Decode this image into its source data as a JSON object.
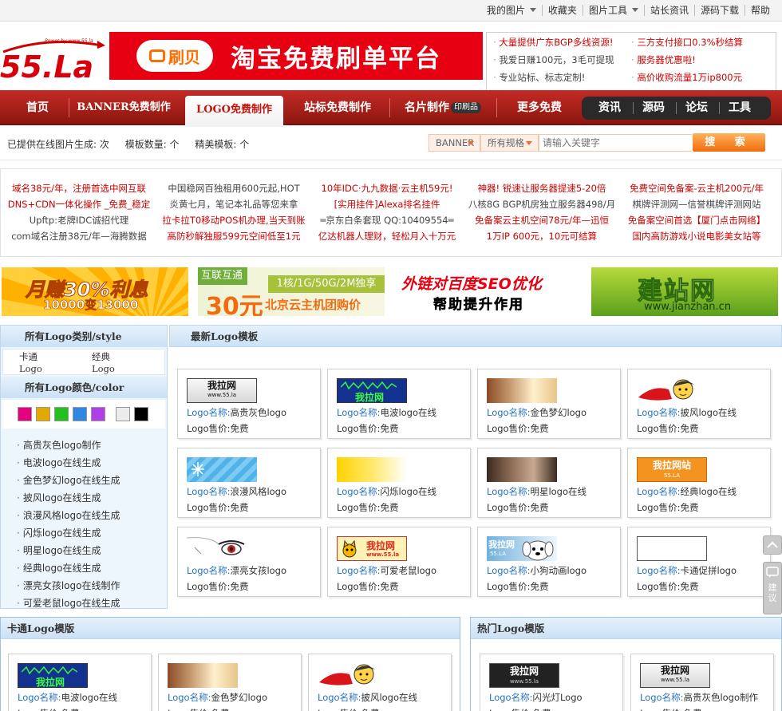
{
  "topbar": {
    "links": [
      "我的图片",
      "收藏夹",
      "图片工具",
      "站长资讯",
      "源码下载",
      "帮助"
    ]
  },
  "logo": {
    "powered_by": "Power by www.55.la",
    "text": "55.La"
  },
  "banner": {
    "brand": "刷贝",
    "slogan": "淘宝免费刷单平台"
  },
  "adbox": {
    "rows": [
      [
        "大量提供广东BGP多线资源!",
        "三方支付接口0.3%秒结算"
      ],
      [
        "我爱日赚100元，3毛可提现",
        "服务器优惠啦!"
      ],
      [
        "专业站标、标志定制!",
        "高价收购流量1万ip800元"
      ]
    ]
  },
  "nav": {
    "items": [
      "首页",
      "BANNER免费制作",
      "LOGO免费制作",
      "站标免费制作",
      "名片制作",
      "更多免费"
    ],
    "card_badge": "印刷品",
    "right_items": [
      "资讯",
      "源码",
      "论坛",
      "工具"
    ]
  },
  "subbar": {
    "stats": [
      "已提供在线图片生成: 次",
      "模板数量: 个",
      "精美模板: 个"
    ],
    "select_type": "BANNER",
    "select_size": "所有规格",
    "search_placeholder": "请输入关键字",
    "search_button": "搜 索"
  },
  "links": [
    [
      "域名38元/年，注册首选中网互联",
      "DNS+CDN一体化操作 _免费_稳定",
      "Upftp:老牌IDC诚招代理",
      "com域名注册38元/年—海腾数据"
    ],
    [
      "中国稳网百独租用600元起,HOT",
      "炎黄七月，笔记本礼品等您来拿",
      "拉卡拉T0移动POS机办理,当天到账",
      "高防秒解独服599元空间低至1元"
    ],
    [
      "10年IDC·九九数据·云主机59元!",
      "[实用挂件]Alexa排名挂件",
      "═京东白条套现 QQ:10409554═",
      "亿达机器人理财，轻松月入十万元"
    ],
    [
      "神器! 锐速让服务器提速5-20倍",
      "八核8G BGP机房独立服务器498/月",
      "免备案云主机空间78元/年—迅恒",
      "1万IP 600元，10元可结算"
    ],
    [
      "免费空间免备案-云主机200元/年",
      "棋牌评测网—信誉棋牌评测网站",
      "免备案空间首选【厦门点击网络】",
      "国内高防游戏小说电影美女站等"
    ]
  ],
  "ads": {
    "ad1": {
      "title": "月赚30%利息",
      "sub": "10000变13000"
    },
    "ad2": {
      "tag": "互联互通",
      "spec": "1核/1G/50G/2M独享",
      "price": "30元",
      "sub": "北京云主机团购价"
    },
    "ad3": {
      "line1": "外链对百度SEO优化",
      "line2": "帮助提升作用"
    },
    "ad4": {
      "title": "建站网",
      "url": "www.jianzhan.cn"
    }
  },
  "sidebar": {
    "category_title": "所有Logo类别/style",
    "categories": [
      "卡通Logo",
      "经典Logo"
    ],
    "color_title": "所有Logo颜色/color",
    "colors": [
      "#e4007f",
      "#e5a800",
      "#22c21c",
      "#2d87e3",
      "#b03fe8",
      "#ececec",
      "#000000"
    ],
    "list": [
      "高贵灰色logo制作",
      "电波logo在线生成",
      "金色梦幻logo在线生成",
      "披风logo在线生成",
      "浪漫风格logo在线生成",
      "闪烁logo在线生成",
      "明星logo在线生成",
      "经典logo在线生成",
      "漂亮女孩logo在线制作",
      "可爱老鼠logo在线生成"
    ]
  },
  "main": {
    "title": "最新Logo模板",
    "name_label": "Logo名称:",
    "price_label": "Logo售价:",
    "cards": [
      {
        "name": "高贵灰色logo",
        "price": "免费",
        "thumb": "gray",
        "thumb_text": "我拉网",
        "thumb_sub": "www.55.la"
      },
      {
        "name": "电波logo在线",
        "price": "免费",
        "thumb": "wave",
        "thumb_text": "我拉网"
      },
      {
        "name": "金色梦幻logo",
        "price": "免费",
        "thumb": "gold"
      },
      {
        "name": "披风logo在线",
        "price": "免费",
        "thumb": "cape"
      },
      {
        "name": "浪漫风格logo",
        "price": "免费",
        "thumb": "blue"
      },
      {
        "name": "闪烁logo在线",
        "price": "免费",
        "thumb": "yellow"
      },
      {
        "name": "明星logo在线",
        "price": "免费",
        "thumb": "face"
      },
      {
        "name": "经典logo在线",
        "price": "免费",
        "thumb": "orange",
        "thumb_text": "我拉网站",
        "thumb_sub": "55.LA"
      },
      {
        "name": "漂亮女孩logo",
        "price": "免费",
        "thumb": "girl"
      },
      {
        "name": "可爱老鼠logo",
        "price": "免费",
        "thumb": "cat",
        "thumb_text": "我拉网",
        "thumb_sub": "www.55.la"
      },
      {
        "name": "小狗动画logo",
        "price": "免费",
        "thumb": "dog",
        "thumb_text": "我拉网",
        "thumb_sub": "55.LA"
      },
      {
        "name": "卡通促拼logo",
        "price": "免费",
        "thumb": "blank"
      }
    ]
  },
  "bottom_left": {
    "title": "卡通Logo模版",
    "cards": [
      {
        "name": "电波logo在线",
        "price": "免费",
        "thumb": "wave",
        "thumb_text": "我拉网"
      },
      {
        "name": "金色梦幻logo",
        "price": "免费",
        "thumb": "gold"
      },
      {
        "name": "披风logo在线",
        "price": "免费",
        "thumb": "cape"
      }
    ]
  },
  "bottom_right": {
    "title": "热门Logo模版",
    "cards": [
      {
        "name": "闪光灯Logo",
        "price": "免费",
        "thumb": "dark",
        "thumb_text": "我拉网",
        "thumb_sub": "www.55.la"
      },
      {
        "name": "高贵灰色logo制作",
        "price": "免费",
        "thumb": "gray",
        "thumb_text": "我拉网",
        "thumb_sub": "www.55.la"
      }
    ]
  },
  "float": {
    "feedback": "建议"
  }
}
